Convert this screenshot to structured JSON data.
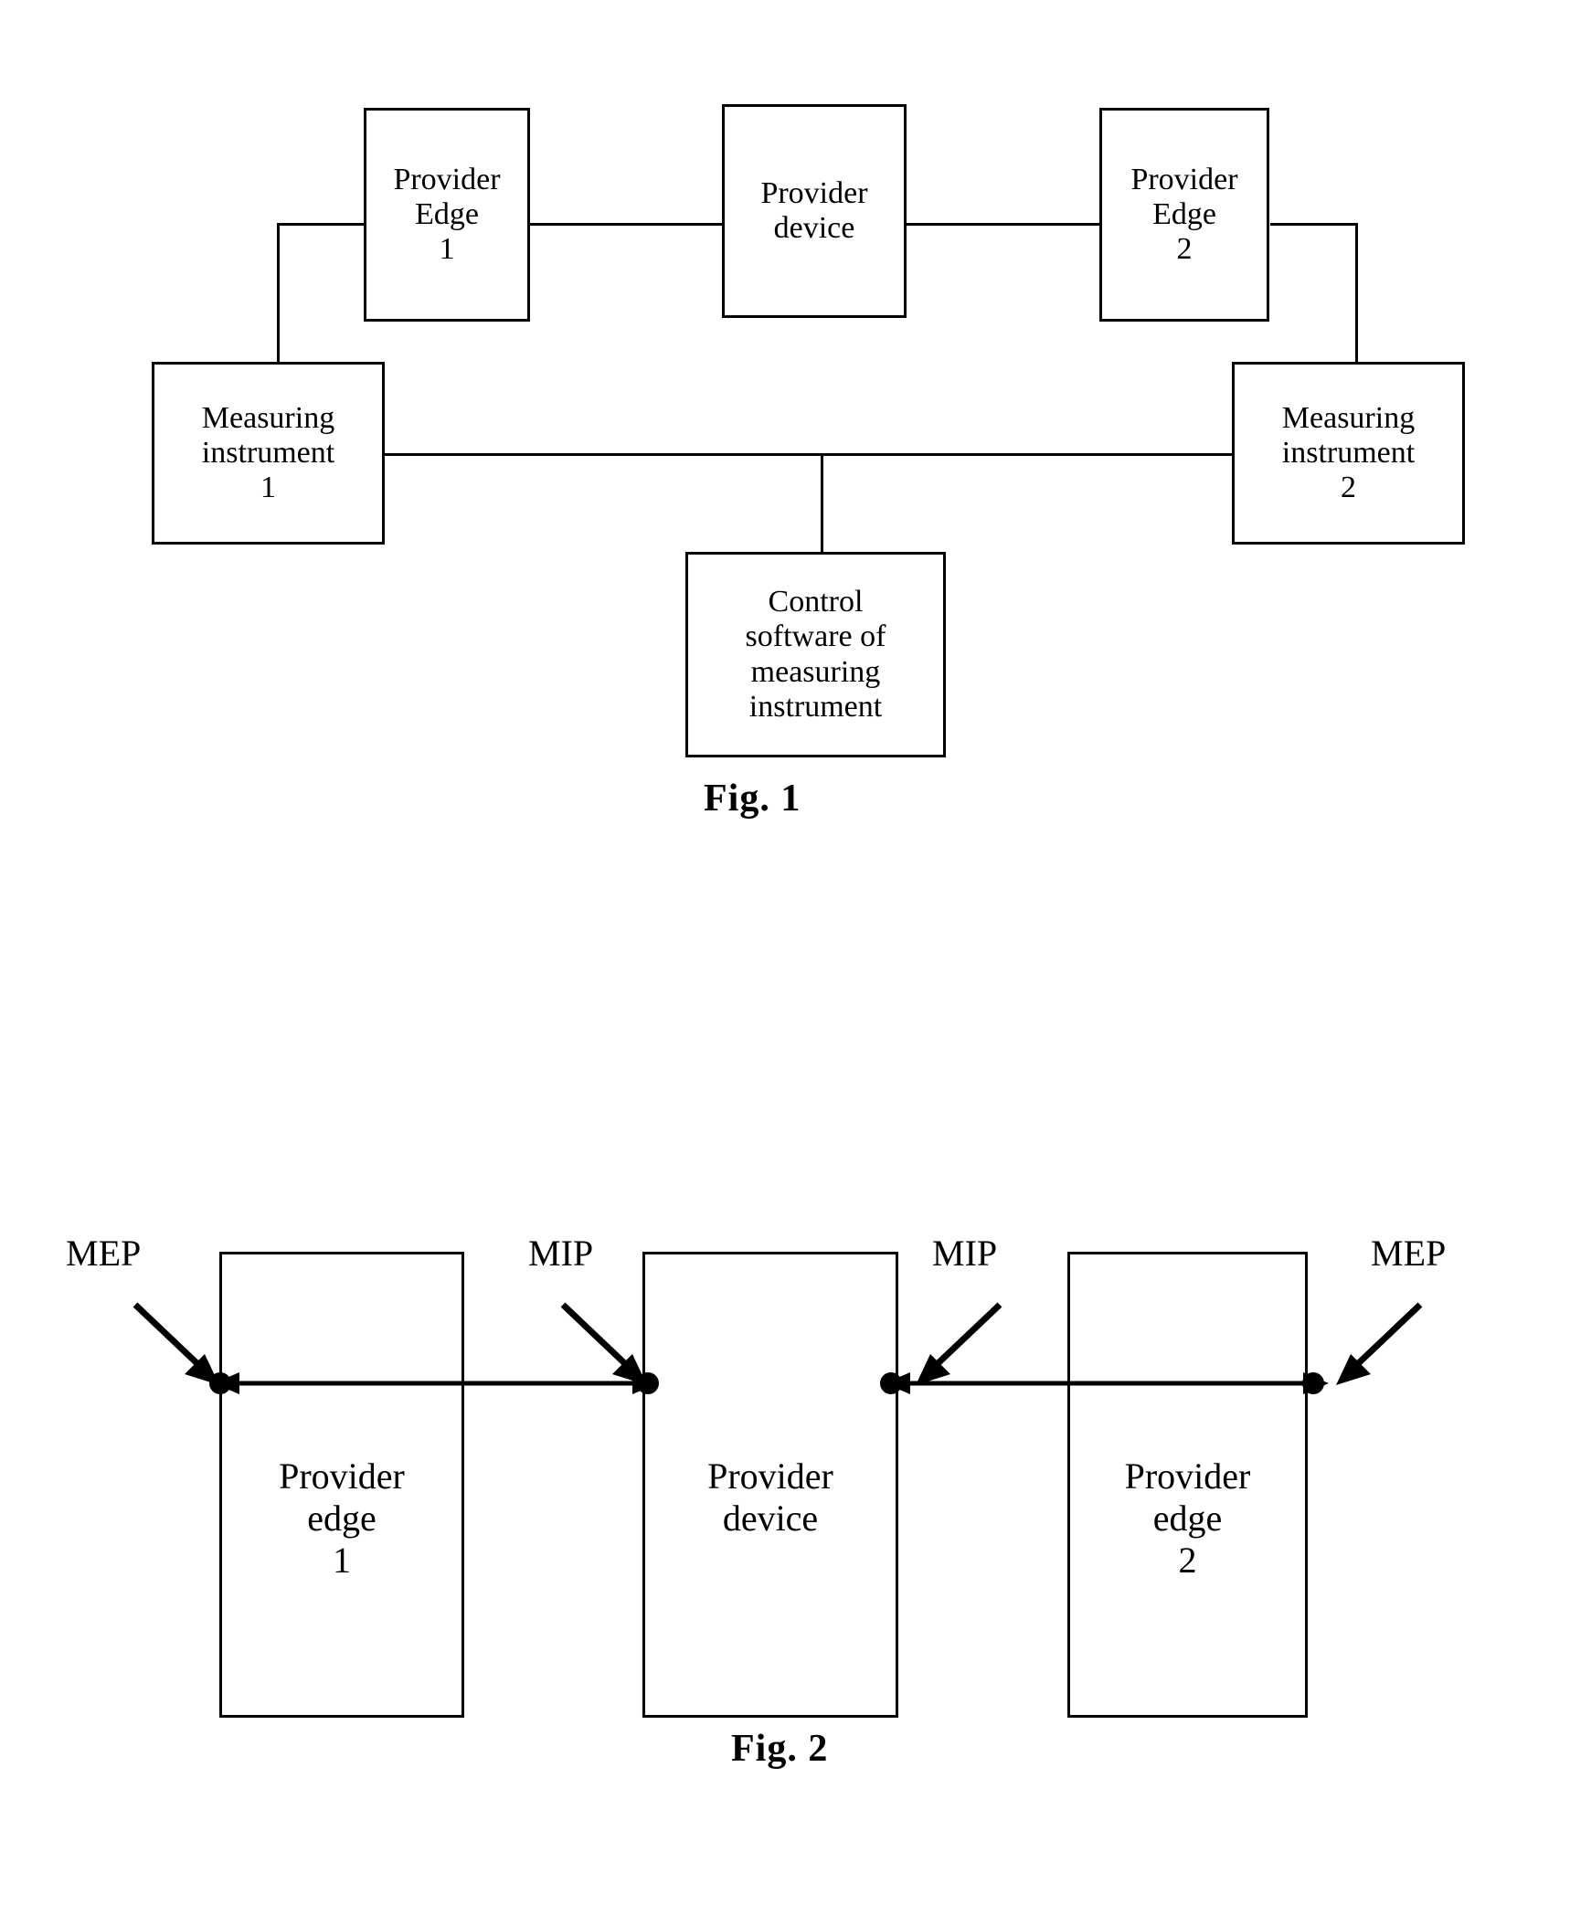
{
  "figure1": {
    "caption": "Fig. 1",
    "nodes": {
      "provider_edge_1": "Provider\nEdge\n1",
      "provider_device": "Provider\ndevice",
      "provider_edge_2": "Provider\nEdge\n2",
      "measuring_instrument_1": "Measuring\ninstrument\n1",
      "measuring_instrument_2": "Measuring\ninstrument\n2",
      "control_software": "Control\nsoftware of\nmeasuring\ninstrument"
    }
  },
  "figure2": {
    "caption": "Fig. 2",
    "nodes": {
      "provider_edge_1": "Provider\nedge\n1",
      "provider_device": "Provider\ndevice",
      "provider_edge_2": "Provider\nedge\n2"
    },
    "points": {
      "mep_left": "MEP",
      "mip_left": "MIP",
      "mip_right": "MIP",
      "mep_right": "MEP"
    }
  },
  "colors": {
    "stroke": "#000000",
    "background": "#ffffff"
  }
}
